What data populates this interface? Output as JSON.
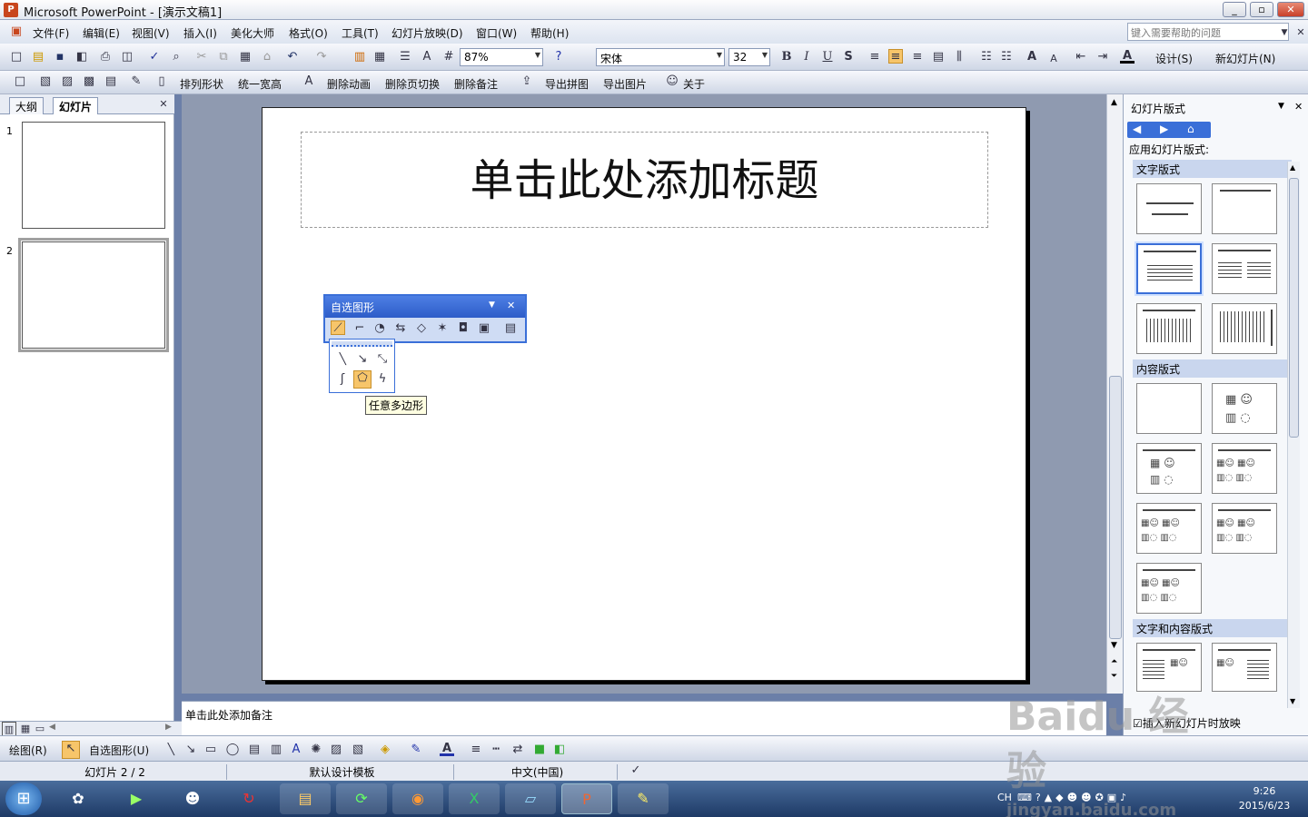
{
  "window": {
    "title": "Microsoft PowerPoint - [演示文稿1]",
    "min": "_",
    "max": "▫",
    "close": "✕"
  },
  "menu": [
    "文件(F)",
    "编辑(E)",
    "视图(V)",
    "插入(I)",
    "美化大师",
    "格式(O)",
    "工具(T)",
    "幻灯片放映(D)",
    "窗口(W)",
    "帮助(H)"
  ],
  "help_placeholder": "键入需要帮助的问题",
  "toolbar1": {
    "zoom": "87%",
    "font": "宋体",
    "size": "32",
    "bold": "B",
    "italic": "I",
    "underline": "U",
    "shadow": "S",
    "design": "设计(S)",
    "new_slide": "新幻灯片(N)"
  },
  "toolbar2": [
    "排列形状",
    "统一宽高",
    "删除动画",
    "删除页切换",
    "删除备注",
    "导出拼图",
    "导出图片",
    "关于"
  ],
  "left_pane": {
    "tab_outline": "大纲",
    "tab_slides": "幻灯片",
    "close": "✕",
    "slides": [
      "1",
      "2"
    ]
  },
  "slide": {
    "title_placeholder": "单击此处添加标题"
  },
  "notes": "单击此处添加备注",
  "autoshape_toolbar": {
    "title": "自选图形",
    "tooltip": "任意多边形"
  },
  "task_pane": {
    "title": "幻灯片版式",
    "apply_label": "应用幻灯片版式:",
    "sections": [
      "文字版式",
      "内容版式",
      "文字和内容版式"
    ],
    "footer_check": "插入新幻灯片时放映"
  },
  "draw_toolbar": {
    "draw": "绘图(R)",
    "autoshapes": "自选图形(U)"
  },
  "status": {
    "slide": "幻灯片 2 / 2",
    "template": "默认设计模板",
    "language": "中文(中国)"
  },
  "tray": {
    "lang": "CH",
    "time": "9:26",
    "date": "2015/6/23"
  },
  "watermark": {
    "brand": "Baidu 经验",
    "url": "jingyan.baidu.com"
  }
}
